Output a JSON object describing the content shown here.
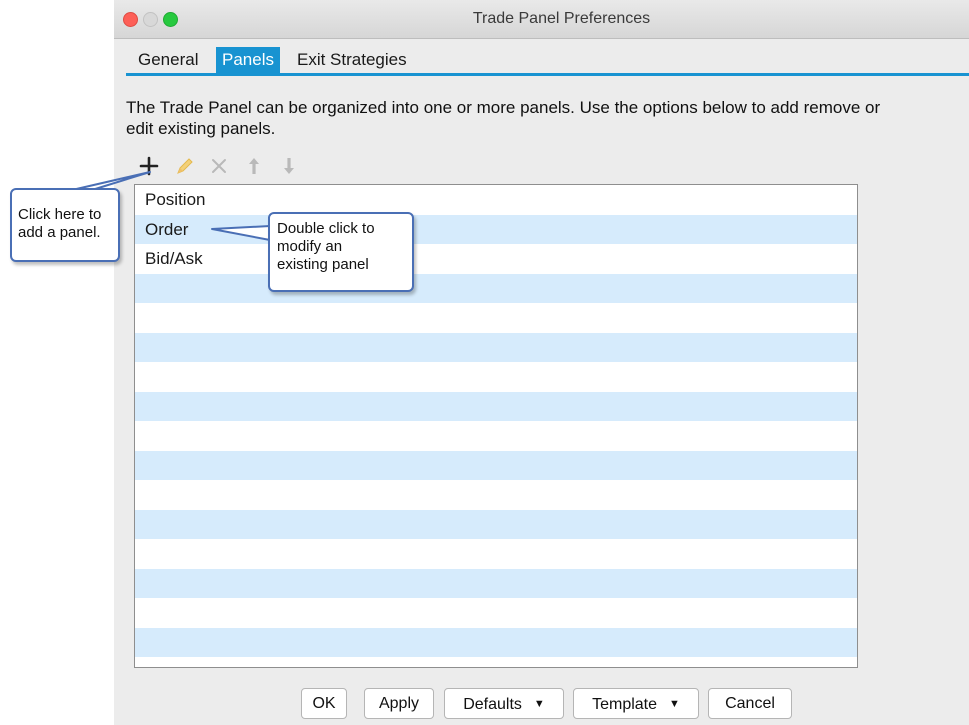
{
  "window": {
    "title": "Trade Panel Preferences"
  },
  "tabs": [
    {
      "label": "General"
    },
    {
      "label": "Panels",
      "selected": true
    },
    {
      "label": "Exit Strategies"
    }
  ],
  "description": {
    "line1": "The Trade Panel can be organized into one or more panels.  Use the options below to add remove or",
    "line2": "edit existing panels."
  },
  "toolbar": {
    "add_icon": "plus-icon",
    "edit_icon": "pencil-icon",
    "remove_icon": "x-icon",
    "up_icon": "arrow-up-icon",
    "down_icon": "arrow-down-icon"
  },
  "panels": [
    "Position",
    "Order",
    "Bid/Ask"
  ],
  "callouts": {
    "add": {
      "line1": "Click here to",
      "line2": "add a panel."
    },
    "edit": {
      "line1": "Double click to",
      "line2": "modify an",
      "line3": "existing panel"
    }
  },
  "buttons": {
    "ok": "OK",
    "apply": "Apply",
    "defaults": "Defaults",
    "template": "Template",
    "cancel": "Cancel",
    "caret": "▼"
  },
  "colors": {
    "accent": "#1893d1",
    "row_stripe": "#d6ebfc",
    "callout_border": "#4a6fb5"
  }
}
